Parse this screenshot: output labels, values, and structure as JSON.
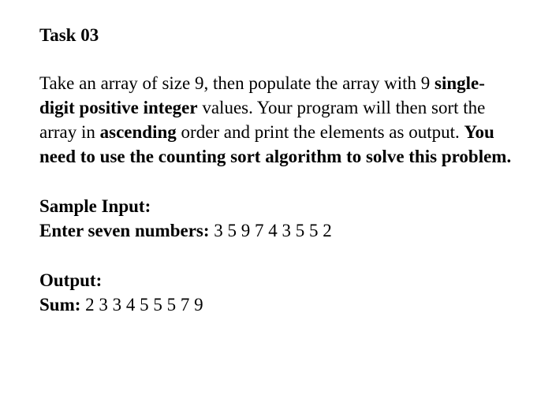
{
  "heading": "Task 03",
  "paragraph": {
    "p1": "Take an array of size 9, then populate the array with 9 ",
    "p2_bold": "single-digit positive integer",
    "p3": " values. Your program will then sort the array in ",
    "p4_bold": "ascending",
    "p5": " order and print the elements as output. ",
    "p6_bold": "You need to use the counting sort algorithm to solve this problem."
  },
  "sample_input": {
    "label": "Sample Input:",
    "prompt": "Enter seven numbers: ",
    "values": "3 5 9 7 4 3 5 5 2"
  },
  "output": {
    "label": "Output:",
    "prompt": "Sum: ",
    "values": "2 3 3 4 5 5 5 7 9"
  }
}
